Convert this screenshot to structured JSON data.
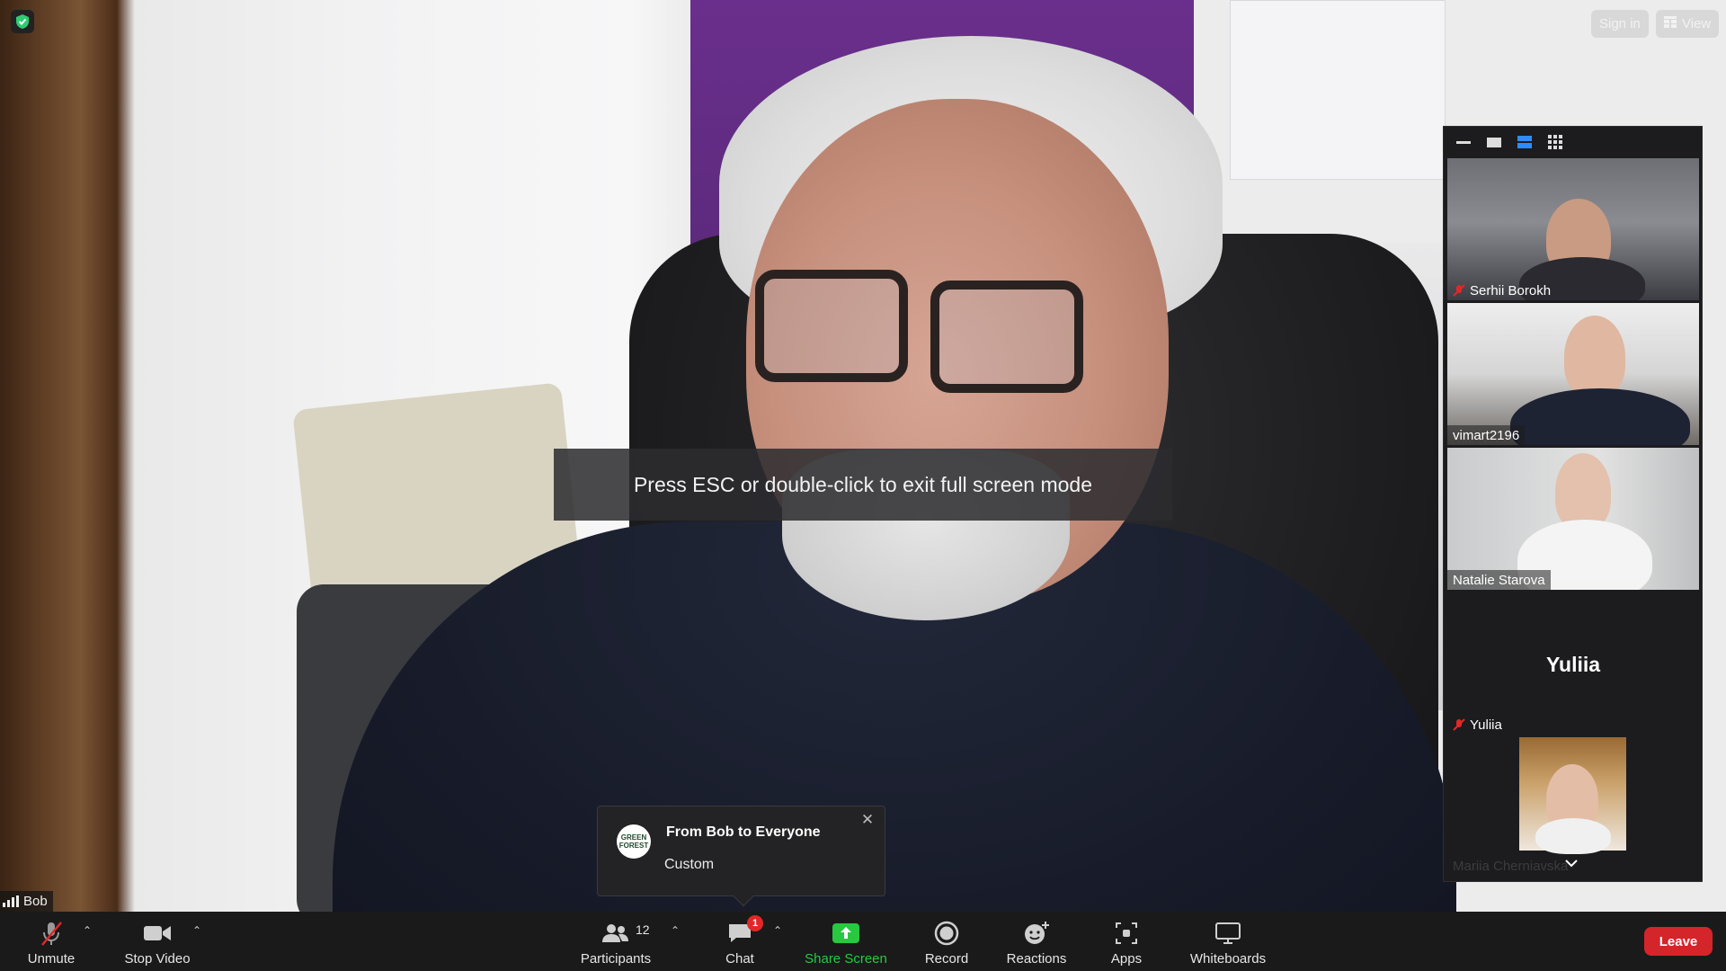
{
  "active_speaker": {
    "name": "Bob"
  },
  "top_buttons": {
    "sign_in": "Sign in",
    "view": "View"
  },
  "fullscreen_notice": "Press ESC or double-click to exit full screen mode",
  "chat_toast": {
    "logo_text": "GREEN FOREST",
    "title": "From Bob to Everyone",
    "message": "Custom"
  },
  "gallery": {
    "participants": [
      {
        "name": "Serhii Borokh",
        "muted": true
      },
      {
        "name": "vimart2196",
        "muted": false
      },
      {
        "name": "Natalie Starova",
        "muted": false
      },
      {
        "name": "Yuliia",
        "muted": true,
        "video_off": true
      },
      {
        "name": "Mariia Cherniavska",
        "muted": false
      }
    ]
  },
  "toolbar": {
    "unmute": "Unmute",
    "stop_video": "Stop Video",
    "participants": "Participants",
    "participants_count": "12",
    "chat": "Chat",
    "chat_badge": "1",
    "share_screen": "Share Screen",
    "record": "Record",
    "reactions": "Reactions",
    "apps": "Apps",
    "whiteboards": "Whiteboards",
    "leave": "Leave"
  },
  "colors": {
    "toolbar_bg": "#1a1a1a",
    "share_green": "#28c840",
    "leave_red": "#d4252b",
    "active_view_blue": "#2d8cff",
    "shield_green": "#2ecc71"
  },
  "icons": [
    "shield-icon",
    "calendar-grid-icon",
    "microphone-muted-icon",
    "video-camera-icon",
    "participants-icon",
    "chat-icon",
    "share-screen-icon",
    "record-icon",
    "reactions-icon",
    "apps-icon",
    "whiteboard-icon",
    "chevron-up-icon",
    "close-icon",
    "signal-icon",
    "chevron-down-icon"
  ]
}
